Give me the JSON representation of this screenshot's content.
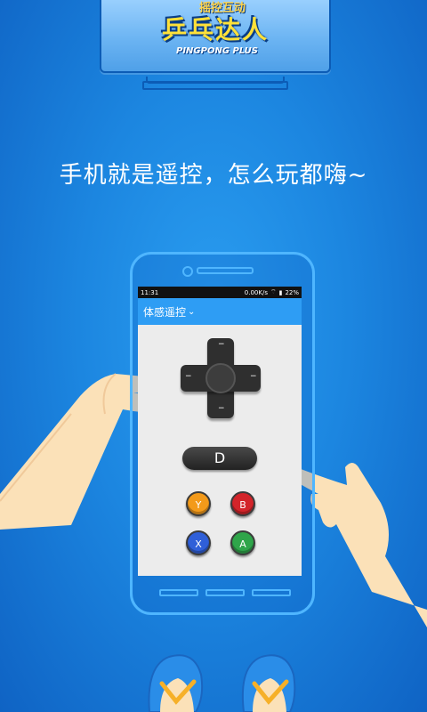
{
  "tv": {
    "game_title_top": "摇控互动",
    "game_title": "乒乓达人",
    "game_subtitle": "PINGPONG PLUS"
  },
  "headline": "手机就是遥控，怎么玩都嗨~",
  "phone": {
    "status": {
      "time": "11:31",
      "speed": "0.00K/s",
      "battery": "22%"
    },
    "appbar": {
      "title": "体感遥控",
      "chevron": "⌄"
    },
    "dpad": {
      "icon": "dpad-icon"
    },
    "d_button_label": "D",
    "buttons": {
      "y": "Y",
      "b": "B",
      "x": "X",
      "a": "A"
    }
  },
  "colors": {
    "background": "#1c86e0",
    "outline": "#4fb6ff",
    "appbar": "#2e9df4",
    "y": "#f39a1a",
    "b": "#d3242a",
    "x": "#2f5fd8",
    "a": "#2fa54a",
    "skin": "#fbe1b8"
  }
}
